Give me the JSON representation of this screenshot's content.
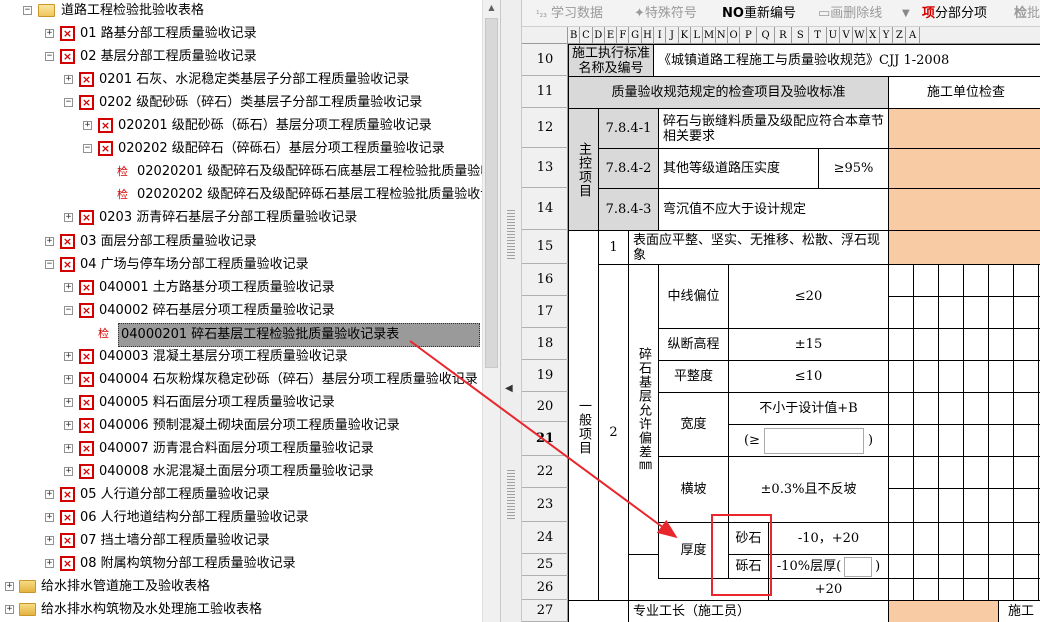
{
  "tree": {
    "root": {
      "label": "道路工程检验批验收表格"
    },
    "items": [
      {
        "label": "01 路基分部工程质量验收记录",
        "icon": "x"
      },
      {
        "label": "02 基层分部工程质量验收记录",
        "icon": "x"
      },
      {
        "label": "0201 石灰、水泥稳定类基层子分部工程质量验收记录",
        "icon": "x"
      },
      {
        "label": "0202 级配砂砾（碎石）类基层子分部工程质量验收记录",
        "icon": "x"
      },
      {
        "label": "020201 级配砂砾（砾石）基层分项工程质量验收记录",
        "icon": "x"
      },
      {
        "label": "020202 级配碎石（碎砾石）基层分项工程质量验收记录",
        "icon": "x"
      },
      {
        "label": "02020201 级配碎石及级配碎砾石底基层工程检验批质量验收",
        "icon": "检"
      },
      {
        "label": "02020202 级配碎石及级配碎砾石基层工程检验批质量验收记",
        "icon": "检"
      },
      {
        "label": "0203 沥青碎石基层子分部工程质量验收记录",
        "icon": "x"
      },
      {
        "label": "03 面层分部工程质量验收记录",
        "icon": "x"
      },
      {
        "label": "04 广场与停车场分部工程质量验收记录",
        "icon": "x"
      },
      {
        "label": "040001 土方路基分项工程质量验收记录",
        "icon": "x"
      },
      {
        "label": "040002 碎石基层分项工程质量验收记录",
        "icon": "x"
      },
      {
        "label": "04000201 碎石基层工程检验批质量验收记录表",
        "icon": "检"
      },
      {
        "label": "040003 混凝土基层分项工程质量验收记录",
        "icon": "x"
      },
      {
        "label": "040004 石灰粉煤灰稳定砂砾（碎石）基层分项工程质量验收记录",
        "icon": "x"
      },
      {
        "label": "040005 料石面层分项工程质量验收记录",
        "icon": "x"
      },
      {
        "label": "040006 预制混凝土砌块面层分项工程质量验收记录",
        "icon": "x"
      },
      {
        "label": "040007 沥青混合料面层分项工程质量验收记录",
        "icon": "x"
      },
      {
        "label": "040008 水泥混凝土面层分项工程质量验收记录",
        "icon": "x"
      },
      {
        "label": "05 人行道分部工程质量验收记录",
        "icon": "x"
      },
      {
        "label": "06 人行地道结构分部工程质量验收记录",
        "icon": "x"
      },
      {
        "label": "07 挡土墙分部工程质量验收记录",
        "icon": "x"
      },
      {
        "label": "08 附属构筑物分部工程质量验收记录",
        "icon": "x"
      }
    ],
    "folders": [
      {
        "label": "给水排水管道施工及验收表格"
      },
      {
        "label": "给水排水构筑物及水处理施工验收表格"
      }
    ]
  },
  "toolbar": {
    "study": "学习数据",
    "special": "特殊符号",
    "renumber_prefix": "NO",
    "renumber": "重新编号",
    "strike": "画删除线",
    "divide_prefix": "项",
    "divide": "分部分项",
    "check_prefix": "检",
    "check": "批"
  },
  "columns": [
    "B",
    "C",
    "D",
    "E",
    "F",
    "G",
    "H",
    "I",
    "J",
    "K",
    "L",
    "M",
    "N",
    "O",
    "P",
    "Q",
    "R",
    "S",
    "T",
    "U",
    "V",
    "W",
    "X",
    "Y",
    "Z",
    "A"
  ],
  "rows": [
    "10",
    "11",
    "12",
    "13",
    "14",
    "15",
    "16",
    "17",
    "18",
    "19",
    "20",
    "21",
    "22",
    "23",
    "24",
    "25",
    "26",
    "27"
  ],
  "sheet": {
    "standard_label": "施工执行标准名称及编号",
    "standard_value": "《城镇道路工程施工与质量验收规范》CJJ 1-2008",
    "spec_header": "质量验收规范规定的检查项目及验收标准",
    "unit_header": "施工单位检查",
    "main_control": "主控项目",
    "mc_items": [
      {
        "code": "7.8.4-1",
        "text": "碎石与嵌缝料质量及级配应符合本章节相关要求"
      },
      {
        "code": "7.8.4-2",
        "text": "其他等级道路压实度",
        "value": "≥95%"
      },
      {
        "code": "7.8.4-3",
        "text": "弯沉值不应大于设计规定"
      }
    ],
    "general": "一般项目",
    "g1_no": "1",
    "g1_text": "表面应平整、坚实、无推移、松散、浮石现象",
    "g2_no": "2",
    "g2_group": "碎石基层允许偏差㎜",
    "items": [
      {
        "name": "中线偏位",
        "value": "≤20"
      },
      {
        "name": "纵断高程",
        "value": "±15"
      },
      {
        "name": "平整度",
        "value": "≤10"
      },
      {
        "name": "宽度",
        "value": "不小于设计值+B",
        "value2_prefix": "(≥",
        "value2_suffix": ")"
      },
      {
        "name": "横坡",
        "value": "±0.3%且不反坡"
      }
    ],
    "thickness": "厚度",
    "sand": "砂石",
    "gravel": "砾石",
    "sand_value": "-10，+20",
    "gravel_value": "-10%层厚(",
    "gravel_suffix": ")",
    "gravel_value2": "+20",
    "foreman": "专业工长（施工员）",
    "construction": "施工"
  }
}
